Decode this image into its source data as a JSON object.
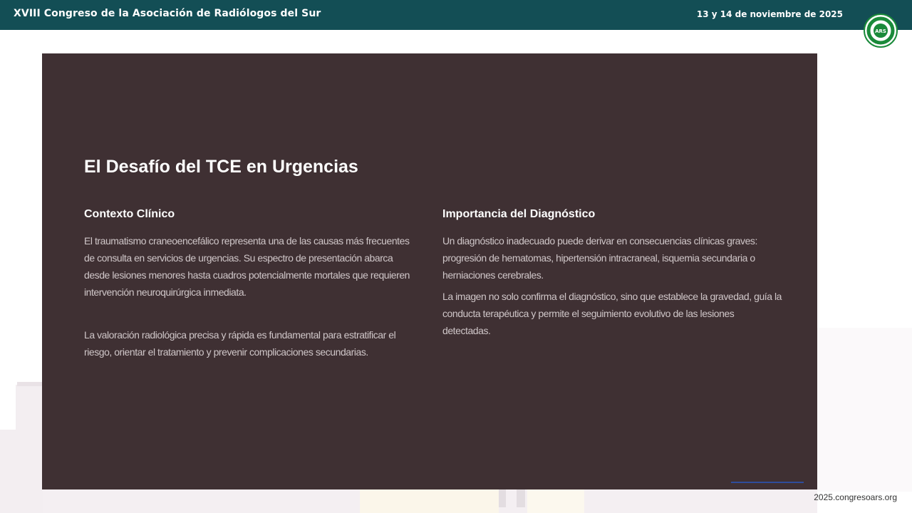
{
  "header": {
    "conference_title": "XVIII Congreso de la Asociación de Radiólogos del Sur",
    "date": "13 y 14 de noviembre de 2025",
    "logo_text": "ARS"
  },
  "slide": {
    "title": "El Desafío del TCE en Urgencias",
    "left_column": {
      "heading": "Contexto Clínico",
      "paragraphs": [
        "El traumatismo craneoencefálico representa una de las causas más frecuentes de consulta en servicios de urgencias. Su espectro de presentación abarca desde lesiones menores hasta cuadros potencialmente mortales que requieren intervención neuroquirúrgica inmediata.",
        "La valoración radiológica precisa y rápida es fundamental para estratificar el riesgo, orientar el tratamiento y prevenir complicaciones secundarias."
      ]
    },
    "right_column": {
      "heading": "Importancia del Diagnóstico",
      "paragraphs": [
        "Un diagnóstico inadecuado puede derivar en consecuencias clínicas graves: progresión de hematomas, hipertensión intracraneal, isquemia secundaria o herniaciones cerebrales.",
        "La imagen no solo confirma el diagnóstico, sino que establece la gravedad, guía la conducta terapéutica y permite el seguimiento evolutivo de las lesiones detectadas."
      ]
    }
  },
  "footer": {
    "url": "2025.congresoars.org"
  },
  "colors": {
    "header_bg": "#134e55",
    "slide_bg": "#3f3033",
    "logo_green": "#1a8a3a"
  }
}
